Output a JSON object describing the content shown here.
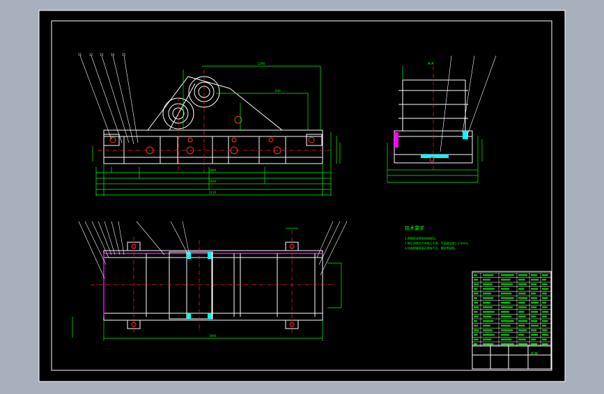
{
  "colors": {
    "background": "#a9b0bd",
    "paper": "#000000",
    "outline": "#ffffff",
    "dimension": "#00ff00",
    "centerline": "#ff2020",
    "magenta": "#ff00ff",
    "cyan": "#00ffff",
    "yellow": "#ffff00"
  },
  "drawing": {
    "section_label": "A-A",
    "notes_title": "技术要求",
    "notes": [
      "1.焊接前去除毛刺和锐边。",
      "2.焊后消除应力并校正平直，平面度误差小于4mm。",
      "3.所有焊缝表面不得有气孔、裂纹等缺陷。"
    ],
    "title_label": "机架"
  }
}
